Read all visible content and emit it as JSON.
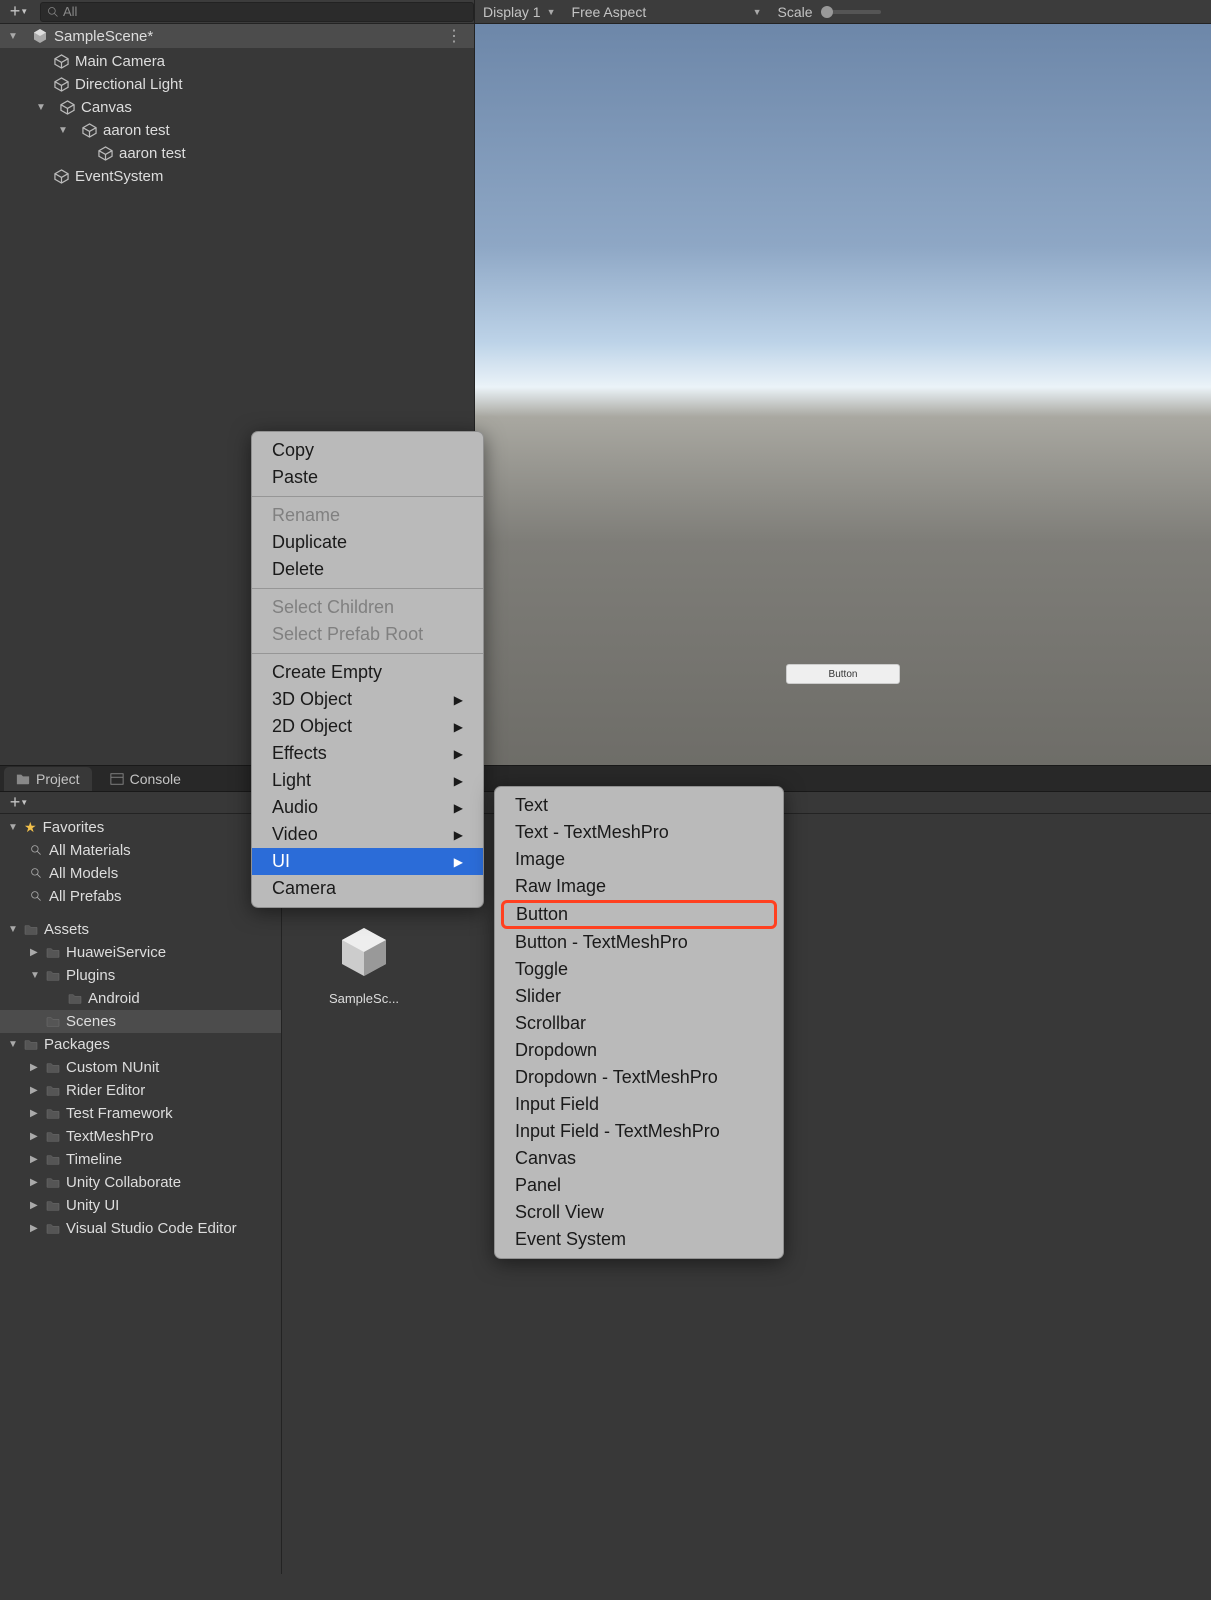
{
  "hierarchy": {
    "search_placeholder": "All",
    "scene_name": "SampleScene*",
    "items": [
      {
        "label": "Main Camera"
      },
      {
        "label": "Directional Light"
      },
      {
        "label": "Canvas"
      },
      {
        "label": "aaron test"
      },
      {
        "label": "aaron test"
      },
      {
        "label": "EventSystem"
      }
    ]
  },
  "gameview": {
    "display": "Display 1",
    "aspect": "Free Aspect",
    "scale_label": "Scale",
    "button_label": "Button"
  },
  "tabs": {
    "project": "Project",
    "console": "Console"
  },
  "project_tree": {
    "favorites": "Favorites",
    "fav_items": [
      {
        "label": "All Materials"
      },
      {
        "label": "All Models"
      },
      {
        "label": "All Prefabs"
      }
    ],
    "assets": "Assets",
    "asset_items": [
      {
        "label": "HuaweiService"
      },
      {
        "label": "Plugins"
      },
      {
        "label": "Android"
      },
      {
        "label": "Scenes"
      }
    ],
    "packages": "Packages",
    "package_items": [
      {
        "label": "Custom NUnit"
      },
      {
        "label": "Rider Editor"
      },
      {
        "label": "Test Framework"
      },
      {
        "label": "TextMeshPro"
      },
      {
        "label": "Timeline"
      },
      {
        "label": "Unity Collaborate"
      },
      {
        "label": "Unity UI"
      },
      {
        "label": "Visual Studio Code Editor"
      }
    ]
  },
  "folder_content": {
    "sample_scene": "SampleSc..."
  },
  "context_menu": {
    "copy": "Copy",
    "paste": "Paste",
    "rename": "Rename",
    "duplicate": "Duplicate",
    "delete": "Delete",
    "select_children": "Select Children",
    "select_prefab_root": "Select Prefab Root",
    "create_empty": "Create Empty",
    "obj3d": "3D Object",
    "obj2d": "2D Object",
    "effects": "Effects",
    "light": "Light",
    "audio": "Audio",
    "video": "Video",
    "ui": "UI",
    "camera": "Camera"
  },
  "submenu": {
    "items": [
      "Text",
      "Text - TextMeshPro",
      "Image",
      "Raw Image",
      "Button",
      "Button - TextMeshPro",
      "Toggle",
      "Slider",
      "Scrollbar",
      "Dropdown",
      "Dropdown - TextMeshPro",
      "Input Field",
      "Input Field - TextMeshPro",
      "Canvas",
      "Panel",
      "Scroll View",
      "Event System"
    ]
  }
}
